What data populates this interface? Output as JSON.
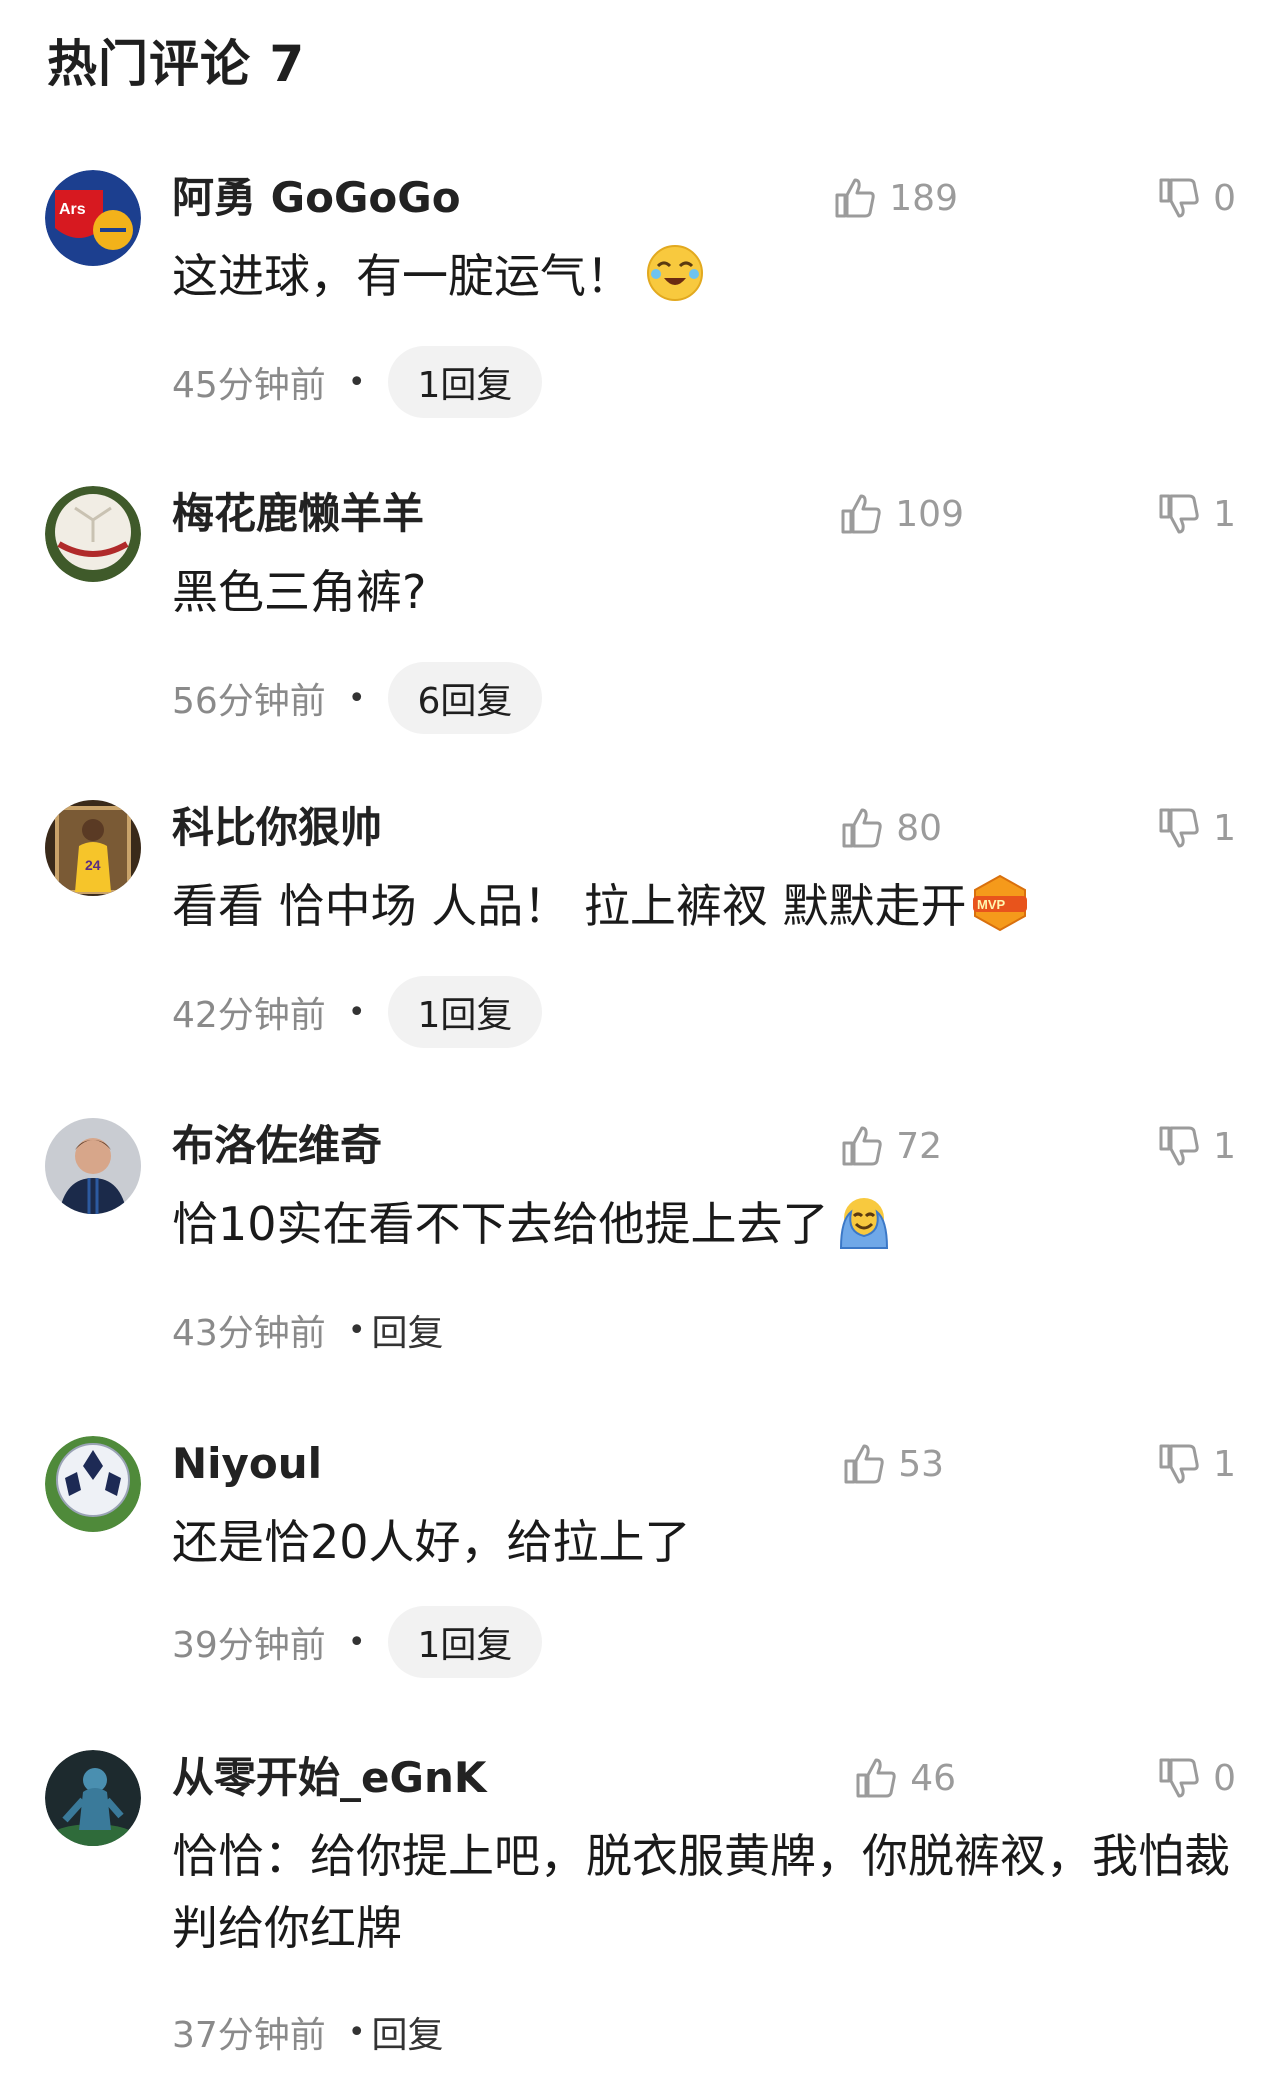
{
  "header": {
    "title": "热门评论 7"
  },
  "comments": [
    {
      "user": "阿勇 GoGoGo",
      "avatar": "arsenal-crest-avatar",
      "likes": "189",
      "dislikes": "0",
      "text": "这进球，有一腚运气！",
      "emoji": "crying-laughing-emoji",
      "time": "45分钟前",
      "reply": "1回复"
    },
    {
      "user": "梅花鹿懒羊羊",
      "avatar": "soccer-ball-avatar",
      "likes": "109",
      "dislikes": "1",
      "text": "黑色三角裤?",
      "time": "56分钟前",
      "reply": "6回复"
    },
    {
      "user": "科比你狠帅",
      "avatar": "kobe-photo-avatar",
      "likes": "80",
      "dislikes": "1",
      "text": "看看 恰中场 人品！ 拉上裤衩 默默走开",
      "emoji": "mvp-badge-emoji",
      "time": "42分钟前",
      "reply": "1回复"
    },
    {
      "user": "布洛佐维奇",
      "avatar": "player-portrait-avatar",
      "likes": "72",
      "dislikes": "1",
      "text": "恰10实在看不下去给他提上去了",
      "emoji": "blanket-laugh-emoji",
      "time": "43分钟前",
      "reply": "回复"
    },
    {
      "user": "Niyoul",
      "avatar": "champions-ball-avatar",
      "likes": "53",
      "dislikes": "1",
      "text": "还是恰20人好，给拉上了",
      "time": "39分钟前",
      "reply": "1回复"
    },
    {
      "user": "从零开始_eGnK",
      "avatar": "game-character-avatar",
      "likes": "46",
      "dislikes": "0",
      "text": "恰恰：给你提上吧，脱衣服黄牌，你脱裤衩，我怕裁判给你红牌",
      "time": "37分钟前",
      "reply": "回复"
    }
  ],
  "colors": {
    "meta_text": "#8a8a8a",
    "pill_bg": "#f2f2f2",
    "vote_text": "#9b9b9b"
  }
}
